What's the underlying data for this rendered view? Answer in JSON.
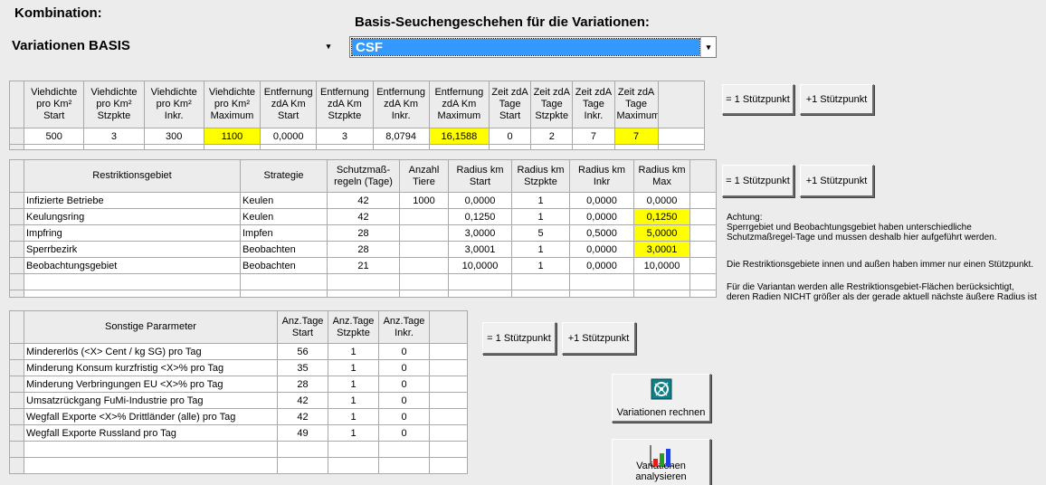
{
  "header": {
    "kombination_label": "Kombination:",
    "kombination_value": "Variationen BASIS",
    "basis_label": "Basis-Seuchengeschehen für die Variationen:",
    "basis_value": "CSF",
    "colors": {
      "selection_blue": "#3399ff",
      "highlight_yellow": "#ffff00",
      "background": "#ececec"
    }
  },
  "icons": {
    "dropdown": "▾",
    "combo_arrow_icon": "chevron-down-icon",
    "rechnen_icon": "calculator-swirl-icon",
    "analysieren_icon": "bar-chart-icon"
  },
  "buttons": {
    "eq1": "= 1 Stützpunkt",
    "plus1": "+1 Stützpunkt",
    "rechnen": "Variationen rechnen",
    "analysieren": "Variationen analysieren"
  },
  "grid1": {
    "headers": [
      "Viehdichte\npro Km²\nStart",
      "Viehdichte\npro Km²\nStzpkte",
      "Viehdichte\npro Km²\nInkr.",
      "Viehdichte\npro Km²\nMaximum",
      "Entfernung\nzdA Km\nStart",
      "Entfernung\nzdA Km\nStzpkte",
      "Entfernung\nzdA Km\nInkr.",
      "Entfernung\nzdA Km\nMaximum",
      "Zeit zdA\nTage\nStart",
      "Zeit zdA\nTage\nStzpkte",
      "Zeit zdA\nTage\nInkr.",
      "Zeit zdA\nTage\nMaximum"
    ],
    "values": [
      "500",
      "3",
      "300",
      "1100",
      "0,0000",
      "3",
      "8,0794",
      "16,1588",
      "0",
      "2",
      "7",
      "7"
    ]
  },
  "grid2": {
    "headers": [
      "Restriktionsgebiet",
      "Strategie",
      "Schutzmaß-\nregeln (Tage)",
      "Anzahl\nTiere",
      "Radius km\nStart",
      "Radius km\nStzpkte",
      "Radius km\nInkr",
      "Radius km\nMax"
    ],
    "rows": [
      [
        "Infizierte Betriebe",
        "Keulen",
        "42",
        "1000",
        "0,0000",
        "1",
        "0,0000",
        "0,0000"
      ],
      [
        "Keulungsring",
        "Keulen",
        "42",
        "",
        "0,1250",
        "1",
        "0,0000",
        "0,1250"
      ],
      [
        "Impfring",
        "Impfen",
        "28",
        "",
        "3,0000",
        "5",
        "0,5000",
        "5,0000"
      ],
      [
        "Sperrbezirk",
        "Beobachten",
        "28",
        "",
        "3,0001",
        "1",
        "0,0000",
        "3,0001"
      ],
      [
        "Beobachtungsgebiet",
        "Beobachten",
        "21",
        "",
        "10,0000",
        "1",
        "0,0000",
        "10,0000"
      ]
    ]
  },
  "grid3": {
    "headers": [
      "Sonstige Pararmeter",
      "Anz.Tage\nStart",
      "Anz.Tage\nStzpkte",
      "Anz.Tage\nInkr."
    ],
    "rows": [
      [
        "Mindererlös (<X> Cent / kg SG) pro Tag",
        "56",
        "1",
        "0"
      ],
      [
        "Minderung Konsum kurzfristig <X>% pro Tag",
        "35",
        "1",
        "0"
      ],
      [
        "Minderung Verbringungen EU <X>% pro Tag",
        "28",
        "1",
        "0"
      ],
      [
        "Umsatzrückgang FuMi-Industrie pro Tag",
        "42",
        "1",
        "0"
      ],
      [
        "Wegfall Exporte <X>% Drittländer (alle) pro Tag",
        "42",
        "1",
        "0"
      ],
      [
        "Wegfall Exporte Russland pro Tag",
        "49",
        "1",
        "0"
      ]
    ]
  },
  "notes": {
    "line1": "Achtung:",
    "line2": "Sperrgebiet und Beobachtungsgebiet haben unterschiedliche",
    "line3": "Schutzmaßregel-Tage und mussen deshalb hier aufgeführt werden.",
    "line4": "Die Restriktionsgebiete innen und außen haben immer nur einen Stützpunkt.",
    "line5": "Für die Variantan werden alle Restriktionsgebiet-Flächen berücksichtigt,",
    "line6": "deren Radien NICHT größer als der gerade aktuell nächste äußere Radius ist"
  }
}
